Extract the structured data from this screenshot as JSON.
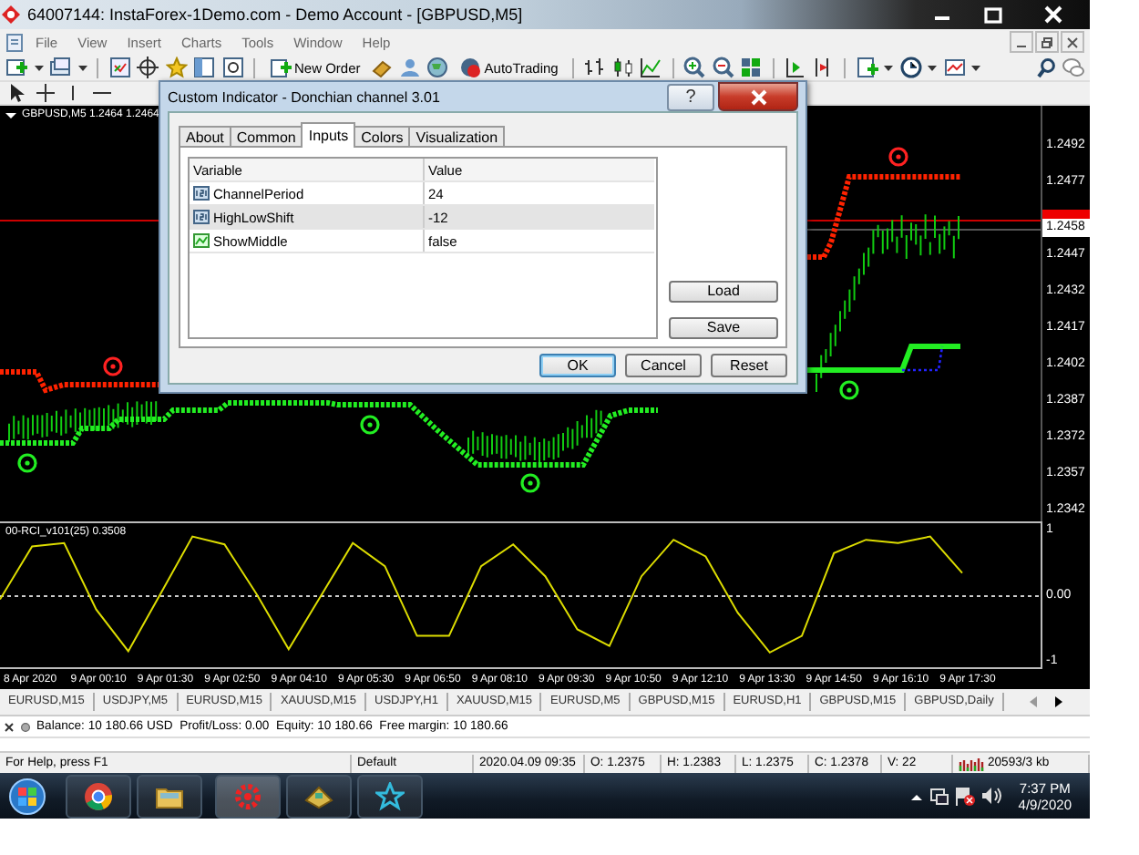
{
  "window": {
    "title": "64007144: InstaForex-1Demo.com - Demo Account - [GBPUSD,M5]"
  },
  "menu": [
    "File",
    "View",
    "Insert",
    "Charts",
    "Tools",
    "Window",
    "Help"
  ],
  "toolbar": {
    "new_order": "New Order",
    "auto_trading": "AutoTrading"
  },
  "chart": {
    "header": "GBPUSD,M5 1.2464 1.2464",
    "price_labels": [
      "1.2492",
      "1.2477",
      "1.2447",
      "1.2432",
      "1.2417",
      "1.2402",
      "1.2387",
      "1.2372",
      "1.2357",
      "1.2342"
    ],
    "current_price": "1.2458",
    "indicator": {
      "chart_data": {
        "type": "line",
        "title": "00-RCI_v101(25) 0.3508",
        "ylim": [
          -1.1,
          1.1
        ],
        "yticks": [
          {
            "value": 1,
            "label": "1"
          },
          {
            "value": 0,
            "label": "0.00"
          },
          {
            "value": -1,
            "label": "-1"
          }
        ],
        "series": [
          {
            "color": "#dddd00",
            "values": [
              -0.05,
              0.75,
              0.8,
              -0.2,
              -0.83,
              0.03,
              0.9,
              0.78,
              0.03,
              -0.8,
              0,
              0.8,
              0.45,
              -0.6,
              -0.6,
              0.45,
              0.78,
              0.3,
              -0.5,
              -0.75,
              0.3,
              0.85,
              0.6,
              -0.25,
              -0.85,
              -0.6,
              0.65,
              0.85,
              0.8,
              0.9,
              0.35
            ]
          }
        ]
      }
    },
    "time_labels": [
      "8 Apr 2020",
      "9 Apr 00:10",
      "9 Apr 01:30",
      "9 Apr 02:50",
      "9 Apr 04:10",
      "9 Apr 05:30",
      "9 Apr 06:50",
      "9 Apr 08:10",
      "9 Apr 09:30",
      "9 Apr 10:50",
      "9 Apr 12:10",
      "9 Apr 13:30",
      "9 Apr 14:50",
      "9 Apr 16:10",
      "9 Apr 17:30"
    ]
  },
  "dialog": {
    "title": "Custom Indicator - Donchian channel 3.01",
    "help": "?",
    "tabs": [
      {
        "label": "About",
        "selected": false
      },
      {
        "label": "Common",
        "selected": false
      },
      {
        "label": "Inputs",
        "selected": true
      },
      {
        "label": "Colors",
        "selected": false
      },
      {
        "label": "Visualization",
        "selected": false
      }
    ],
    "columns": [
      "Variable",
      "Value"
    ],
    "rows": [
      {
        "kind": "int",
        "name": "ChannelPeriod",
        "value": "24",
        "selected": false
      },
      {
        "kind": "int",
        "name": "HighLowShift",
        "value": "-12",
        "selected": true
      },
      {
        "kind": "bool",
        "name": "ShowMiddle",
        "value": "false",
        "selected": false
      }
    ],
    "side_buttons": [
      "Load",
      "Save"
    ],
    "buttons": [
      {
        "label": "OK",
        "default": true
      },
      {
        "label": "Cancel",
        "default": false
      },
      {
        "label": "Reset",
        "default": false
      }
    ]
  },
  "chart_tabs": [
    {
      "label": "EURUSD,M15",
      "selected": false
    },
    {
      "label": "USDJPY,M5",
      "selected": false
    },
    {
      "label": "EURUSD,M15",
      "selected": false
    },
    {
      "label": "XAUUSD,M15",
      "selected": false
    },
    {
      "label": "USDJPY,H1",
      "selected": false
    },
    {
      "label": "XAUUSD,M15",
      "selected": false
    },
    {
      "label": "EURUSD,M5",
      "selected": false
    },
    {
      "label": "GBPUSD,M15",
      "selected": false
    },
    {
      "label": "EURUSD,H1",
      "selected": false
    },
    {
      "label": "GBPUSD,M15",
      "selected": false
    },
    {
      "label": "GBPUSD,Daily",
      "selected": false
    }
  ],
  "account_line": "Balance: 10 180.66 USD  Profit/Loss: 0.00  Equity: 10 180.66  Free margin: 10 180.66",
  "status_bar": [
    {
      "kind": "text",
      "text": "For Help, press F1"
    },
    {
      "kind": "text",
      "text": "Default"
    },
    {
      "kind": "text",
      "text": "2020.04.09 09:35"
    },
    {
      "kind": "text",
      "text": "O: 1.2375"
    },
    {
      "kind": "text",
      "text": "H: 1.2383"
    },
    {
      "kind": "text",
      "text": "L: 1.2375"
    },
    {
      "kind": "text",
      "text": "C: 1.2378"
    },
    {
      "kind": "text",
      "text": "V: 22"
    },
    {
      "kind": "connection",
      "text": "20593/3 kb"
    }
  ],
  "taskbar": {
    "time": "7:37 PM",
    "date": "4/9/2020"
  }
}
